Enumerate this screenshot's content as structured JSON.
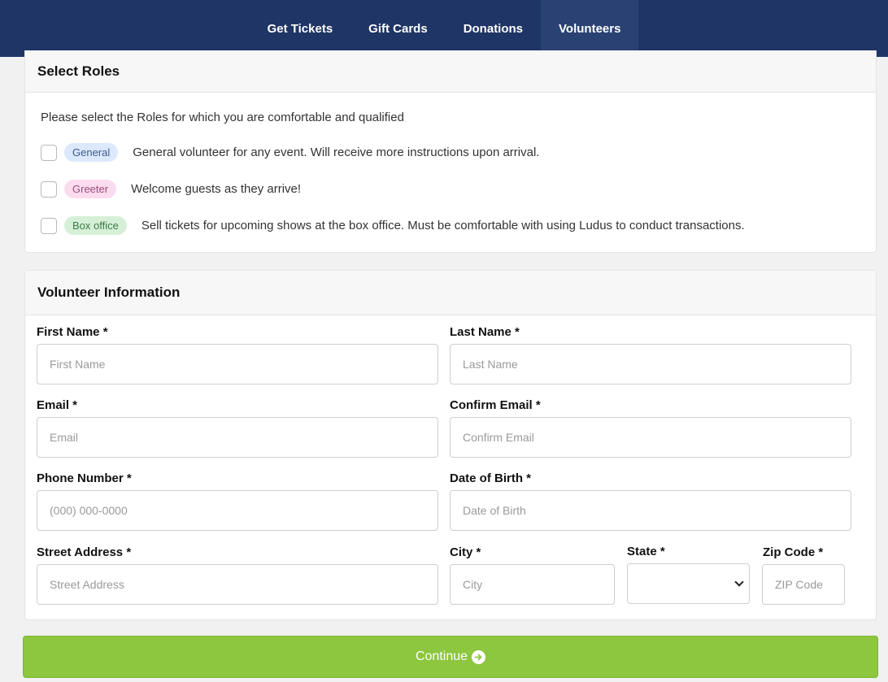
{
  "nav": {
    "items": [
      {
        "label": "Get Tickets"
      },
      {
        "label": "Gift Cards"
      },
      {
        "label": "Donations"
      },
      {
        "label": "Volunteers"
      }
    ]
  },
  "roles": {
    "title": "Select Roles",
    "intro": "Please select the Roles for which you are comfortable and qualified",
    "items": [
      {
        "badge": "General",
        "description": "General volunteer for any event. Will receive more instructions upon arrival.",
        "checked": false
      },
      {
        "badge": "Greeter",
        "description": "Welcome guests as they arrive!",
        "checked": false
      },
      {
        "badge": "Box office",
        "description": "Sell tickets for upcoming shows at the box office. Must be comfortable with using Ludus to conduct transactions.",
        "checked": false
      }
    ]
  },
  "info": {
    "title": "Volunteer Information",
    "fields": {
      "first_name": {
        "label": "First Name *",
        "placeholder": "First Name",
        "value": ""
      },
      "last_name": {
        "label": "Last Name *",
        "placeholder": "Last Name",
        "value": ""
      },
      "email": {
        "label": "Email *",
        "placeholder": "Email",
        "value": ""
      },
      "confirm_email": {
        "label": "Confirm Email *",
        "placeholder": "Confirm Email",
        "value": ""
      },
      "phone": {
        "label": "Phone Number *",
        "placeholder": "(000) 000-0000",
        "value": ""
      },
      "dob": {
        "label": "Date of Birth *",
        "placeholder": "Date of Birth",
        "value": ""
      },
      "street": {
        "label": "Street Address *",
        "placeholder": "Street Address",
        "value": ""
      },
      "city": {
        "label": "City *",
        "placeholder": "City",
        "value": ""
      },
      "state": {
        "label": "State *",
        "value": ""
      },
      "zip": {
        "label": "Zip Code *",
        "placeholder": "ZIP Code",
        "value": ""
      }
    }
  },
  "continue_label": "Continue",
  "colors": {
    "nav_bg": "#1f3566",
    "nav_active": "#2a4273",
    "continue_bg": "#8dc63f"
  }
}
